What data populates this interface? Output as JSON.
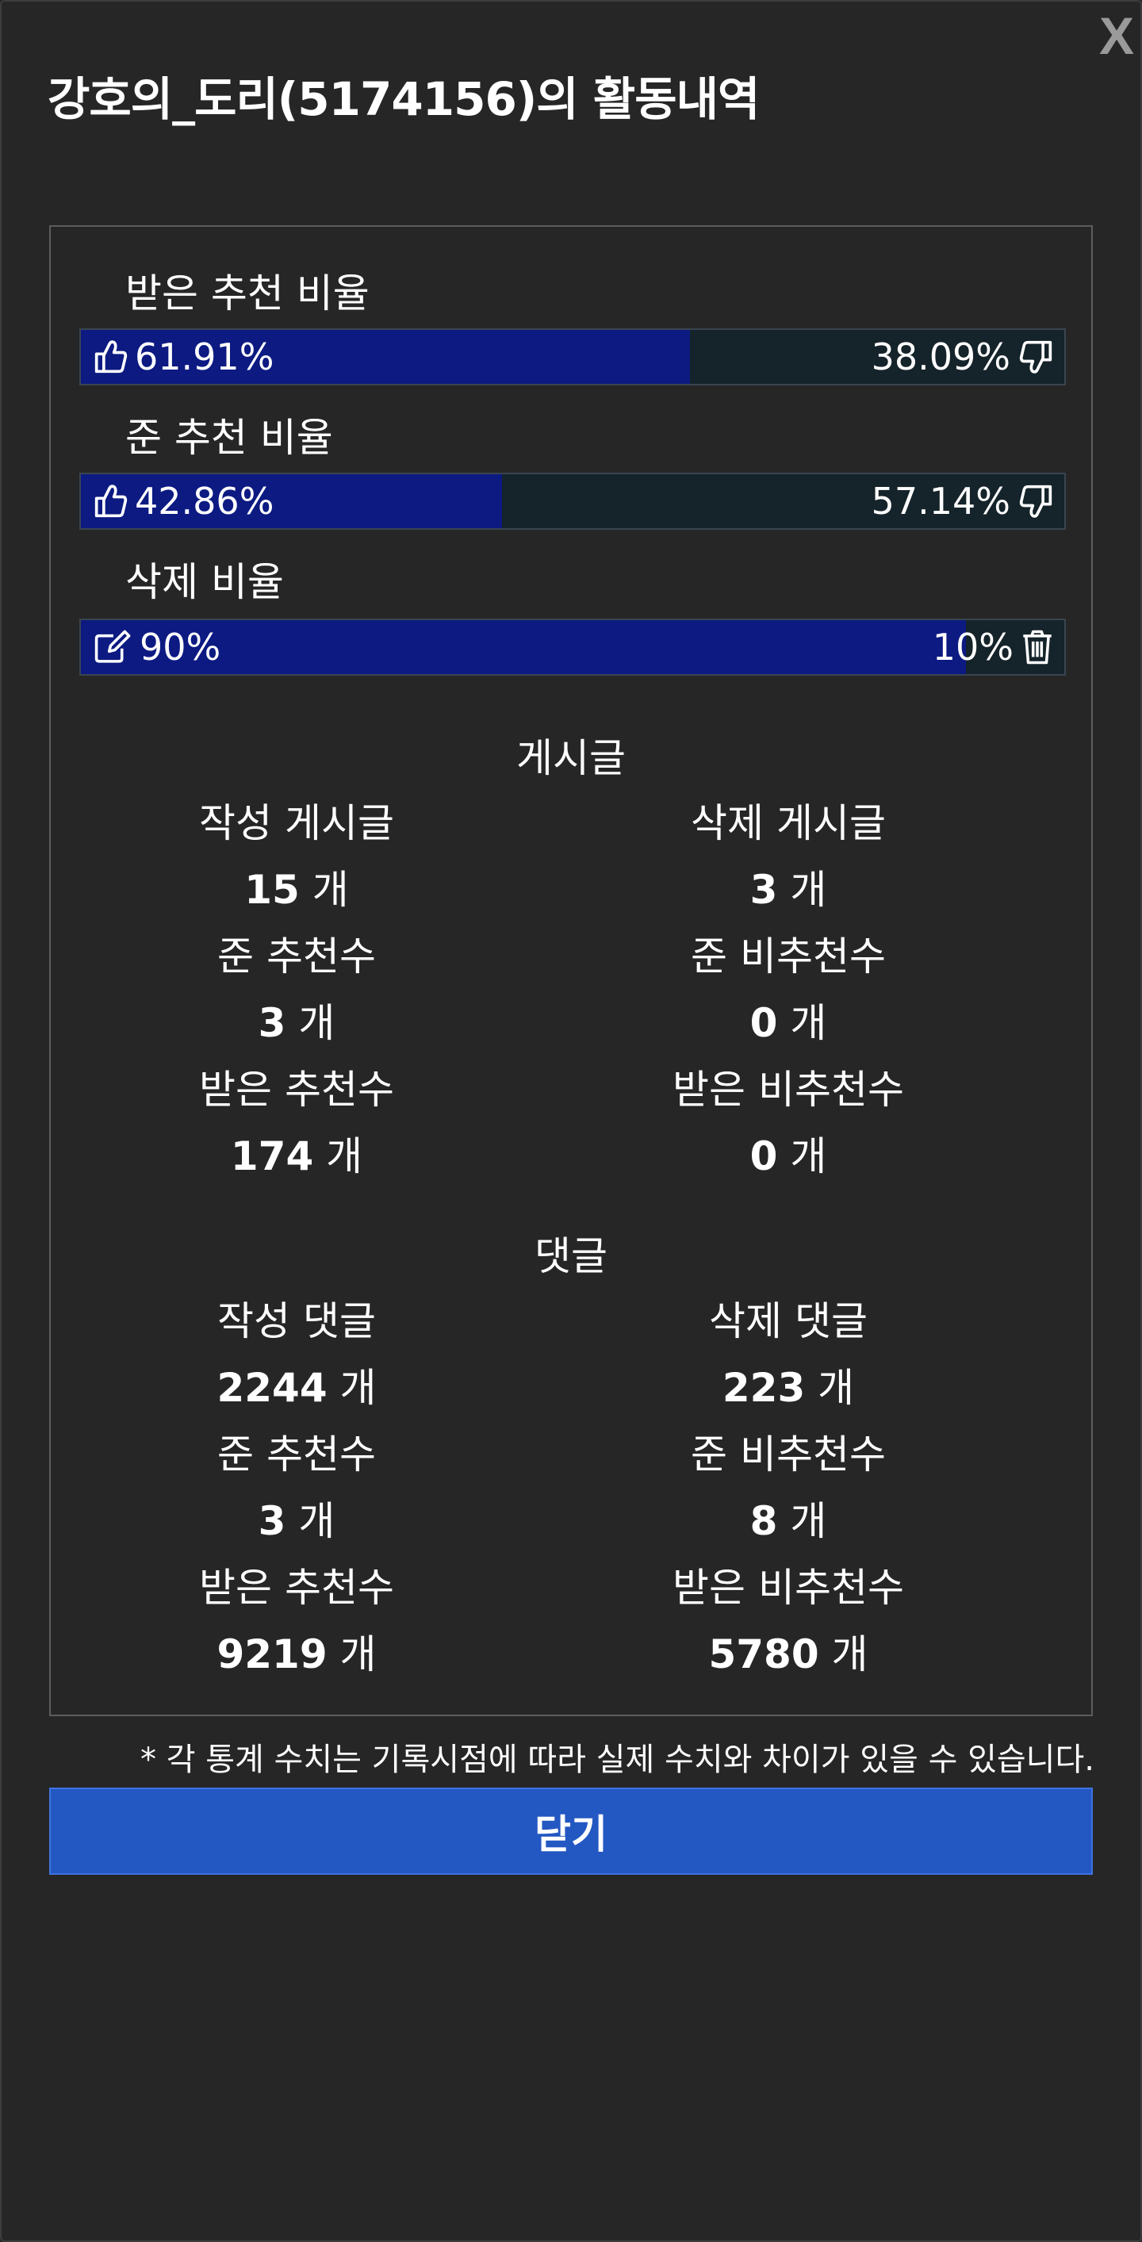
{
  "close_x": "X",
  "title": "강호의_도리(5174156)의 활동내역",
  "ratios": {
    "received": {
      "label": "받은 추천 비율",
      "up_text": "61.91%",
      "down_text": "38.09%",
      "up_fraction": 0.6191
    },
    "given": {
      "label": "준 추천 비율",
      "up_text": "42.86%",
      "down_text": "57.14%",
      "up_fraction": 0.4286
    },
    "deleted": {
      "label": "삭제 비율",
      "up_text": "90%",
      "down_text": "10%",
      "up_fraction": 0.9
    }
  },
  "posts": {
    "title": "게시글",
    "written_label": "작성 게시글",
    "written_value": "15",
    "deleted_label": "삭제 게시글",
    "deleted_value": "3",
    "given_up_label": "준 추천수",
    "given_up_value": "3",
    "given_down_label": "준 비추천수",
    "given_down_value": "0",
    "received_up_label": "받은 추천수",
    "received_up_value": "174",
    "received_down_label": "받은 비추천수",
    "received_down_value": "0"
  },
  "comments": {
    "title": "댓글",
    "written_label": "작성 댓글",
    "written_value": "2244",
    "deleted_label": "삭제 댓글",
    "deleted_value": "223",
    "given_up_label": "준 추천수",
    "given_up_value": "3",
    "given_down_label": "준 비추천수",
    "given_down_value": "8",
    "received_up_label": "받은 추천수",
    "received_up_value": "9219",
    "received_down_label": "받은 비추천수",
    "received_down_value": "5780"
  },
  "unit": "개",
  "note": "* 각 통계 수치는 기록시점에 따라 실제 수치와 차이가 있을 수 있습니다.",
  "close_button": "닫기",
  "colors": {
    "background": "#262626",
    "bar_fill": "#0c1a82",
    "bar_track": "#15232a",
    "button": "#2357c2"
  },
  "icons": {
    "up": "thumbs-up-icon",
    "down": "thumbs-down-icon",
    "edit": "edit-icon",
    "delete": "trash-icon"
  }
}
